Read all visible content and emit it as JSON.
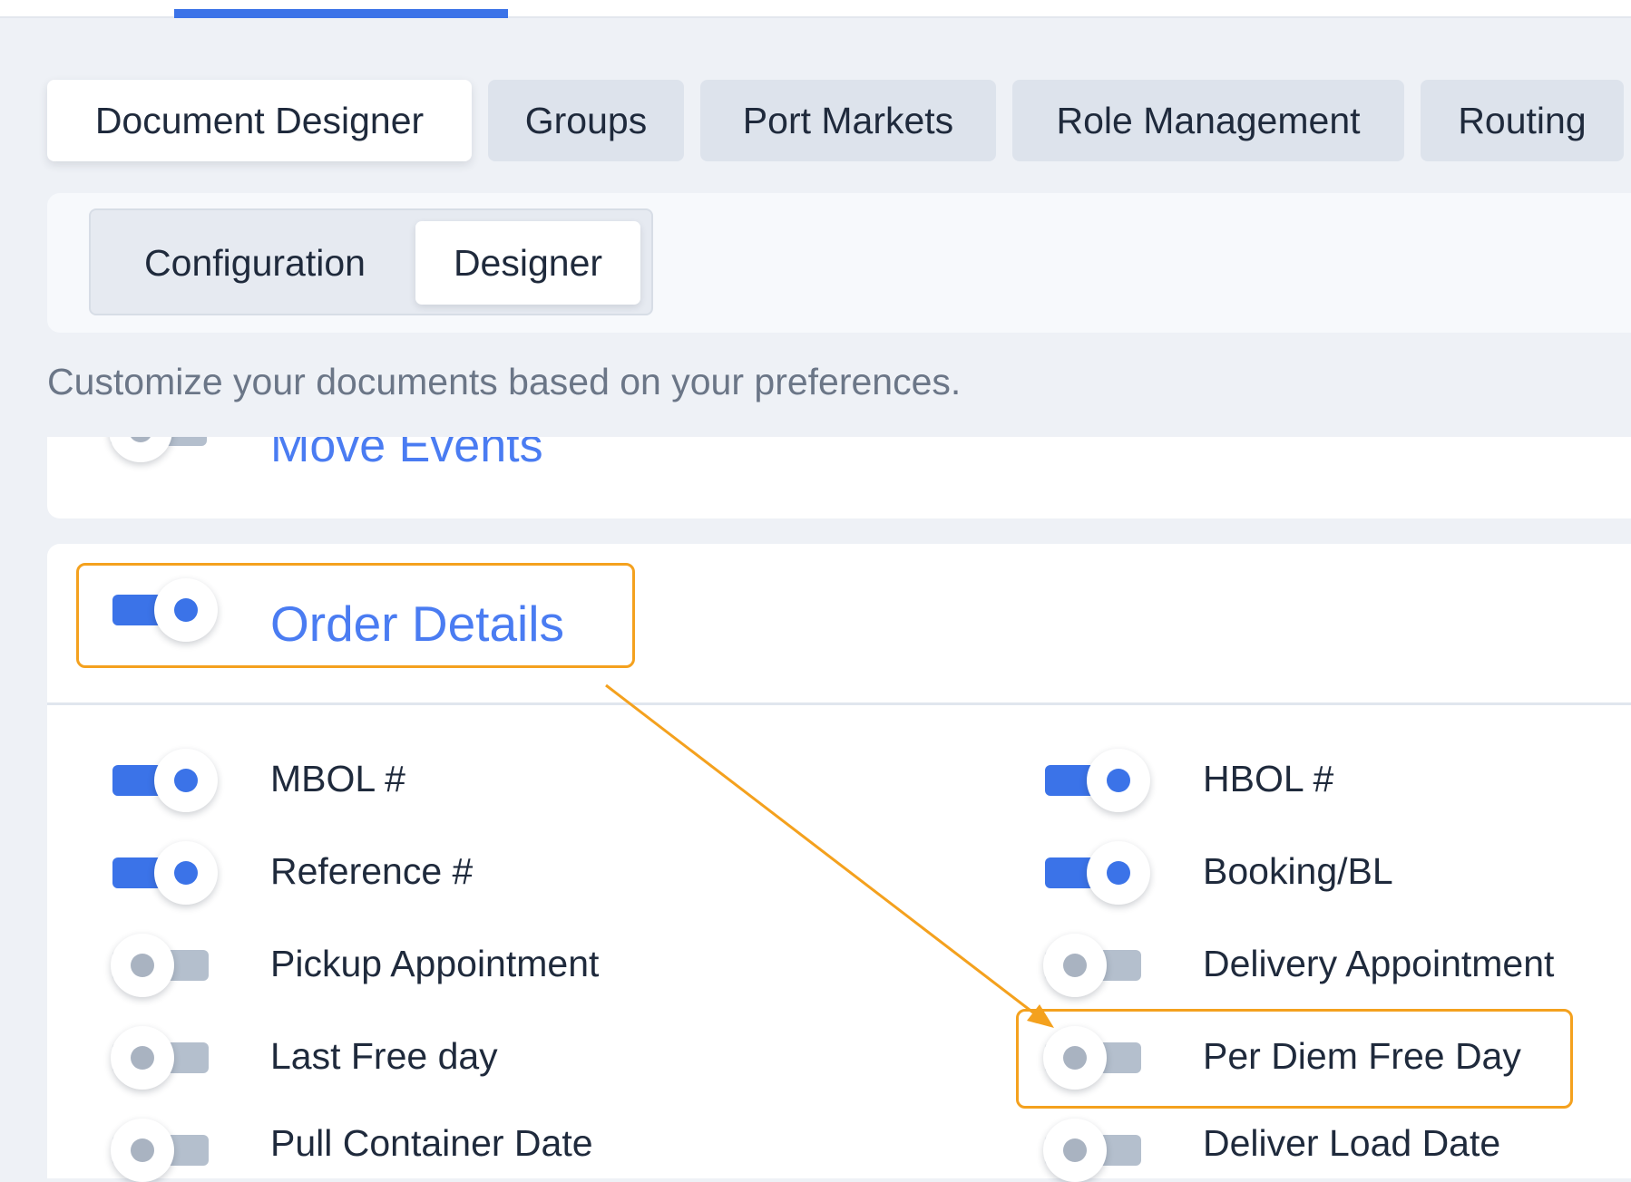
{
  "main_tabs": [
    {
      "label": "Document Designer",
      "active": true
    },
    {
      "label": "Groups",
      "active": false
    },
    {
      "label": "Port Markets",
      "active": false
    },
    {
      "label": "Role Management",
      "active": false
    },
    {
      "label": "Routing",
      "active": false
    }
  ],
  "sub_tabs": [
    {
      "label": "Configuration",
      "active": false
    },
    {
      "label": "Designer",
      "active": true
    }
  ],
  "description": "Customize your documents based on your preferences.",
  "sections": {
    "move_events": {
      "title": "Move Events",
      "enabled": false
    },
    "order_details": {
      "title": "Order Details",
      "enabled": true,
      "fields": [
        {
          "label": "MBOL #",
          "enabled": true
        },
        {
          "label": "HBOL #",
          "enabled": true
        },
        {
          "label": "Reference #",
          "enabled": true
        },
        {
          "label": "Booking/BL",
          "enabled": true
        },
        {
          "label": "Pickup Appointment",
          "enabled": false
        },
        {
          "label": "Delivery Appointment",
          "enabled": false
        },
        {
          "label": "Last Free day",
          "enabled": false
        },
        {
          "label": "Per Diem Free Day",
          "enabled": false
        },
        {
          "label": "Pull Container Date",
          "enabled": false
        },
        {
          "label": "Deliver Load Date",
          "enabled": false
        }
      ]
    }
  },
  "colors": {
    "accent": "#3b73e8",
    "title_blue": "#4a7cf2",
    "annotation": "#f4a11e",
    "toggle_off": "#b4bfcd"
  }
}
